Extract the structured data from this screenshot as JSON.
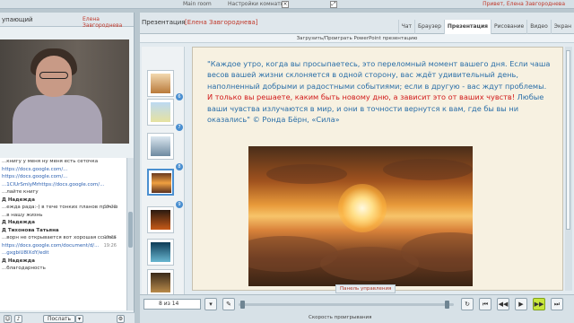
{
  "topbar": {
    "room_label": "Main room",
    "settings_label": "Настройки комнаты",
    "greeting": "Привет, Елена Завгороднева",
    "close_icon": "close-icon"
  },
  "left": {
    "header_title": "упающий",
    "header_user": "Елена Завгороднева",
    "chat": [
      {
        "text": "...книгу у меня ну меня есть сеточка",
        "kind": "msg",
        "time": ""
      },
      {
        "text": "https://docs.google.com/...",
        "kind": "link",
        "time": ""
      },
      {
        "text": "https://docs.google.com/...",
        "kind": "link",
        "time": ""
      },
      {
        "text": "...1ClUrSmlyMrhttps://docs.google.com/...",
        "kind": "link",
        "time": ""
      },
      {
        "text": "...лайте книгу",
        "kind": "msg",
        "time": ""
      },
      {
        "text": "Д Надежда",
        "kind": "name",
        "time": ""
      },
      {
        "text": "...ежда рада:-) в тече тонких планов прочно",
        "kind": "msg",
        "time": "19:26"
      },
      {
        "text": "...в нашу жизнь",
        "kind": "msg",
        "time": ""
      },
      {
        "text": "Д Надежда",
        "kind": "name",
        "time": ""
      },
      {
        "text": "Д Тихонова Татьяна",
        "kind": "name",
        "time": ""
      },
      {
        "text": "...ворн не открывается вот хорошая ссылка",
        "kind": "msg",
        "time": "19:26"
      },
      {
        "text": "https://docs.google.com/document/d/...",
        "kind": "link",
        "time": "19:26"
      },
      {
        "text": "...gxgbiU8lXdY/edit",
        "kind": "link",
        "time": ""
      },
      {
        "text": "Д Надежда",
        "kind": "name",
        "time": ""
      },
      {
        "text": "...благодарность",
        "kind": "msg",
        "time": ""
      }
    ],
    "send_label": "Послать"
  },
  "main": {
    "header_title": "Презентация",
    "header_name": "[Елена Завгороднева]",
    "tabs": [
      "Чат",
      "Браузер",
      "Презентация",
      "Рисование",
      "Видео",
      "Экран"
    ],
    "active_tab": 2,
    "upload_label": "Загрузить/Проиграть PowerPoint презентацию",
    "thumb_numbers": [
      "6",
      "7",
      "8",
      "9",
      "10"
    ],
    "slide": {
      "text_main": "\"Каждое утро, когда вы просыпаетесь, это переломный момент вашего дня. Если чаша весов вашей жизни склоняется в одной сторону, вас ждёт удивительный день, наполненный добрыми и радостными событиями; если в другую - вас ждут проблемы. ",
      "text_red": "И только вы решаете, каким быть новому дню, а зависит это от ваших чувств!",
      "text_tail": " Любые ваши чувства излучаются в мир, и они в точности вернутся к вам, где бы вы ни оказались\" © Ронда Бёрн, «Сила»"
    },
    "panel_label": "Панель управления",
    "page_indicator": "8 из 14",
    "speed_label": "Скорость проигрывания"
  }
}
